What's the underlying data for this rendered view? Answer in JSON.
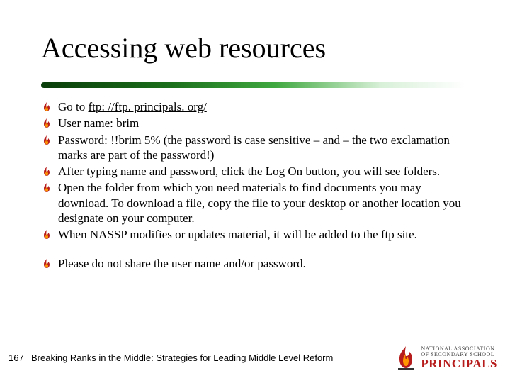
{
  "title": "Accessing web resources",
  "bullets": {
    "b0_pre": "Go to ",
    "b0_link": "ftp: //ftp. principals. org/",
    "b1": "User name: brim",
    "b2": "Password:   !!brim 5% (the password is case sensitive – and – the two exclamation marks are part of the password!)",
    "b3": "After typing name and password, click the Log On button, you will see folders.",
    "b4": "Open the folder from which you need materials to find documents you may download. To download a file, copy the file to your desktop or another location you designate on your computer.",
    "b5": "When NASSP modifies or updates material, it will be added to the ftp site.",
    "note": "Please do not share the user name and/or password."
  },
  "footer": {
    "page": "167",
    "text": "Breaking Ranks in the Middle: Strategies for Leading Middle Level Reform"
  },
  "logo": {
    "line1": "NATIONAL ASSOCIATION",
    "line2": "OF SECONDARY SCHOOL",
    "line3": "PRINCIPALS"
  }
}
